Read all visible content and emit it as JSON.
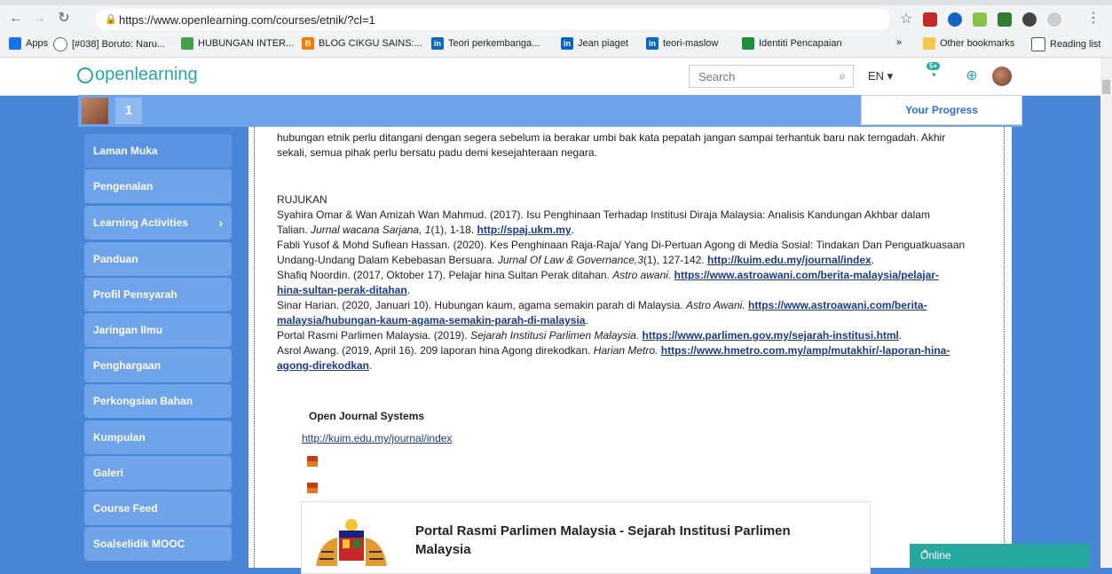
{
  "browser": {
    "url": "https://www.openlearning.com/courses/etnik/?cl=1",
    "bookmarks": [
      "Apps",
      "[#038] Boruto: Naru...",
      "HUBUNGAN INTER...",
      "BLOG CIKGU SAINS:...",
      "Teori perkembanga...",
      "Jean piaget",
      "teori-maslow",
      "Identiti Pencapaian"
    ],
    "other_bookmarks": "Other bookmarks",
    "reading_list": "Reading list",
    "more": "»"
  },
  "header": {
    "logo": "openlearning",
    "search_placeholder": "Search",
    "lang": "EN ▾",
    "badge": "5+"
  },
  "course_bar": {
    "level": "1",
    "progress": "Your Progress"
  },
  "sidebar": {
    "items": [
      {
        "label": "Laman Muka"
      },
      {
        "label": "Pengenalan"
      },
      {
        "label": "Learning Activities"
      },
      {
        "label": "Panduan"
      },
      {
        "label": "Profil Pensyarah"
      },
      {
        "label": "Jaringan Ilmu"
      },
      {
        "label": "Penghargaan"
      },
      {
        "label": "Perkongsian Bahan"
      },
      {
        "label": "Kumpulan"
      },
      {
        "label": "Galeri"
      },
      {
        "label": "Course Feed"
      },
      {
        "label": "Soalselidik MOOC"
      }
    ]
  },
  "content": {
    "intro_line1": "hubungan etnik perlu ditangani dengan segera sebelum ia berakar umbi bak kata pepatah jangan sampai terhantuk baru nak terngadah. Akhir",
    "intro_line2": "sekali, semua pihak perlu bersatu padu demi kesejahteraan negara.",
    "rujukan": "RUJUKAN",
    "ref1_a": "Syahira Omar & Wan Amizah Wan Mahmud. (2017). Isu Penghinaan Terhadap Institusi Diraja Malaysia: Analisis Kandungan Akhbar dalam",
    "ref1_b": "Talian.",
    "ref1_journal": "Jurnal wacana Sarjana,",
    "ref1_vol": "1",
    "ref1_c": "(1), 1-18.",
    "ref1_link": "http://spaj.ukm.my",
    "ref2_a": "Fabli Yusof & Mohd Sufiean Hassan. (2020). Kes Penghinaan Raja-Raja/ Yang Di-Pertuan Agong di Media Sosial: Tindakan Dan Penguatkuasaan",
    "ref2_b": "Undang-Undang Dalam Kebebasan Bersuara.",
    "ref2_journal": "Jurnal Of Law & Governance,",
    "ref2_vol": "3",
    "ref2_c": "(1), 127-142.",
    "ref2_link": "http://kuim.edu.my/journal/index",
    "ref3_a": "Shafiq Noordin. (2017, Oktober 17). Pelajar hina Sultan Perak ditahan.",
    "ref3_journal": "Astro awani.",
    "ref3_link_a": "https://www.astroawani.com/berita-malaysia/pelajar-",
    "ref3_link_b": "hina-sultan-perak-ditahan",
    "ref4_a": "Sinar Harian. (2020, Januari 10). Hubungan kaum, agama semakin parah di Malaysia.",
    "ref4_journal": "Astro Awani.",
    "ref4_link_a": "https://www.astroawani.com/berita-",
    "ref4_link_b": "malaysia/hubungan-kaum-agama-semakin-parah-di-malaysia",
    "ref5_a": "Portal Rasmi Parlimen Malaysia. (2019).",
    "ref5_journal": "Sejarah Institusi Parlimen Malaysia.",
    "ref5_link": "https://www.parlimen.gov.my/sejarah-institusi.html",
    "ref6_a": "Asrol Awang. (2019, April 16). 209 laporan hina Agong direkodkan.",
    "ref6_journal": "Harian Metro.",
    "ref6_link_a": "https://www.hmetro.com.my/amp/mutakhir/-laporan-hina-",
    "ref6_link_b": "agong-direkodkan",
    "dot": ".",
    "ojs_title": "Open Journal Systems",
    "ojs_link": "http://kuim.edu.my/journal/index",
    "card_title": "Portal Rasmi Parlimen Malaysia - Sejarah Institusi Parlimen Malaysia"
  },
  "chat": {
    "label": "Online"
  }
}
